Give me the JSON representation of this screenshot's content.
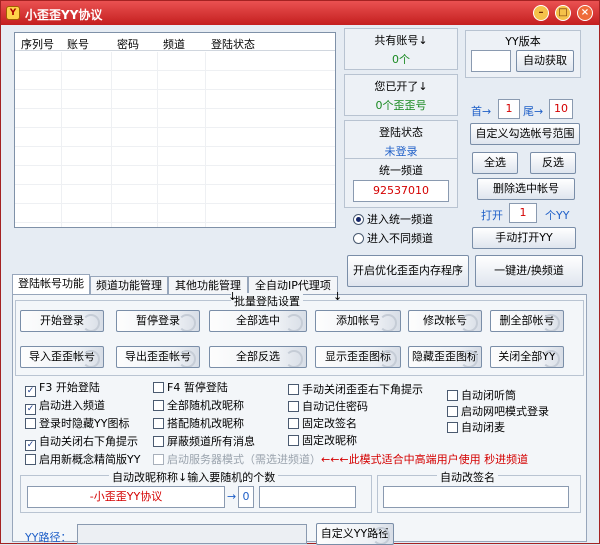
{
  "window": {
    "title": "小歪歪YY协议",
    "min_glyph": "–",
    "max_glyph": "□",
    "close_glyph": "×"
  },
  "table": {
    "columns": [
      "序列号",
      "账号",
      "密码",
      "频道",
      "登陆状态"
    ]
  },
  "stats": {
    "total_label": "共有账号↓",
    "total_value": "0个",
    "opened_label": "您已开了↓",
    "opened_value": "0个歪歪号",
    "status_label": "登陆状态",
    "status_value": "未登录",
    "unified_label": "统一频道",
    "unified_channel": "92537010"
  },
  "radios": {
    "unified": "进入统一频道",
    "different": "进入不同频道"
  },
  "yy": {
    "label": "YY版本",
    "auto_get": "自动获取",
    "version_value": ""
  },
  "range": {
    "first_label": "首→",
    "first_value": "1",
    "last_label": "尾→",
    "last_value": "10",
    "custom_range_button": "自定义勾选帐号范围"
  },
  "select": {
    "all": "全选",
    "invert": "反选",
    "delete_selected": "删除选中帐号"
  },
  "open": {
    "label": "打开",
    "count": "1",
    "unit": "个YY",
    "manual_open": "手动打开YY"
  },
  "big_buttons": {
    "optimize_memory": "开启优化歪歪内存程序",
    "join_switch": "一键进/换频道"
  },
  "tabs": [
    "登陆帐号功能",
    "频道功能管理",
    "其他功能管理",
    "全自动IP代理项"
  ],
  "batch": {
    "group_title": "批量登陆设置",
    "row1": [
      "开始登录",
      "暂停登录",
      "全部选中",
      "添加帐号",
      "修改帐号",
      "删全部帐号"
    ],
    "row2": [
      "导入歪歪帐号",
      "导出歪歪帐号",
      "全部反选",
      "显示歪歪图标",
      "隐藏歪歪图标",
      "关闭全部YY"
    ]
  },
  "checks": {
    "f3": "F3 开始登陆",
    "auto_enter": "启动进入频道",
    "hide_icon": "登录时隐藏YY图标",
    "auto_close_tip": "自动关闭右下角提示",
    "new_concept": "启用新概念精简版YY",
    "f4": "F4 暂停登陆",
    "all_random_nick": "全部随机改昵称",
    "random_nick": "搭配随机改昵称",
    "block_channel_msg": "屏蔽频道所有消息",
    "server_mode": "启动服务器模式（需选进频道）",
    "manual_close_tip": "手动关闭歪歪右下角提示",
    "remember_pwd": "自动记住密码",
    "fixed_sign": "固定改签名",
    "fixed_nick": "固定改昵称",
    "auto_mic_off": "自动闭听筒",
    "netbar_mode": "启动网吧模式登录",
    "auto_mute": "自动闭麦"
  },
  "server_mode_note": "←←←此模式适合中高端用户使用 秒进频道",
  "nick": {
    "label": "自动改昵称称↓输入要随机的个数",
    "value": "-小歪歪YY协议",
    "arrow": "→",
    "random_count": "0",
    "extra": ""
  },
  "signature": {
    "label": "自动改签名",
    "value": ""
  },
  "path": {
    "label": "YY路径：",
    "value": "",
    "button": "自定义YY路径"
  },
  "arrows": {
    "down": "↓"
  },
  "colors": {
    "accent": "#c41f1f",
    "green": "#1a8a22",
    "blue": "#2060c8",
    "red": "#d40000"
  }
}
